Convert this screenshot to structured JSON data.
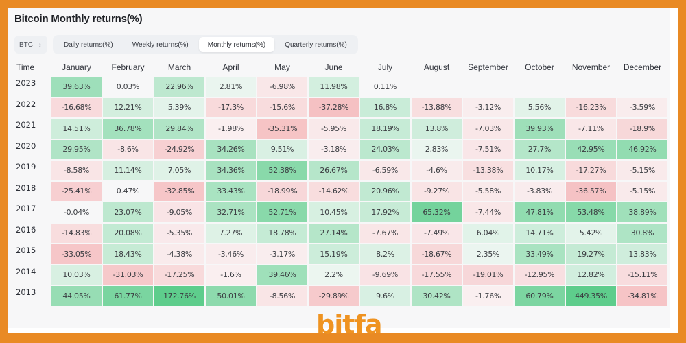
{
  "title": "Bitcoin Monthly returns(%)",
  "asset_select": {
    "value": "BTC",
    "icon": "updown-chevron-icon"
  },
  "tabs": [
    {
      "label": "Daily returns(%)",
      "active": false
    },
    {
      "label": "Weekly returns(%)",
      "active": false
    },
    {
      "label": "Monthly returns(%)",
      "active": true
    },
    {
      "label": "Quarterly returns(%)",
      "active": false
    }
  ],
  "watermark": "bitfa",
  "colors": {
    "frame": "#e98a24",
    "positive_strong": "#5fcf8e",
    "positive_light": "#e8f6ef",
    "negative_strong": "#f4b9bc",
    "negative_light": "#fbeef0"
  },
  "chart_data": {
    "type": "heatmap",
    "title": "Bitcoin Monthly returns(%)",
    "row_header": "Time",
    "columns": [
      "January",
      "February",
      "March",
      "April",
      "May",
      "June",
      "July",
      "August",
      "September",
      "October",
      "November",
      "December"
    ],
    "rows": [
      {
        "year": "2023",
        "values": [
          "39.63%",
          "0.03%",
          "22.96%",
          "2.81%",
          "-6.98%",
          "11.98%",
          "0.11%",
          null,
          null,
          null,
          null,
          null
        ]
      },
      {
        "year": "2022",
        "values": [
          "-16.68%",
          "12.21%",
          "5.39%",
          "-17.3%",
          "-15.6%",
          "-37.28%",
          "16.8%",
          "-13.88%",
          "-3.12%",
          "5.56%",
          "-16.23%",
          "-3.59%"
        ]
      },
      {
        "year": "2021",
        "values": [
          "14.51%",
          "36.78%",
          "29.84%",
          "-1.98%",
          "-35.31%",
          "-5.95%",
          "18.19%",
          "13.8%",
          "-7.03%",
          "39.93%",
          "-7.11%",
          "-18.9%"
        ]
      },
      {
        "year": "2020",
        "values": [
          "29.95%",
          "-8.6%",
          "-24.92%",
          "34.26%",
          "9.51%",
          "-3.18%",
          "24.03%",
          "2.83%",
          "-7.51%",
          "27.7%",
          "42.95%",
          "46.92%"
        ]
      },
      {
        "year": "2019",
        "values": [
          "-8.58%",
          "11.14%",
          "7.05%",
          "34.36%",
          "52.38%",
          "26.67%",
          "-6.59%",
          "-4.6%",
          "-13.38%",
          "10.17%",
          "-17.27%",
          "-5.15%"
        ]
      },
      {
        "year": "2018",
        "values": [
          "-25.41%",
          "0.47%",
          "-32.85%",
          "33.43%",
          "-18.99%",
          "-14.62%",
          "20.96%",
          "-9.27%",
          "-5.58%",
          "-3.83%",
          "-36.57%",
          "-5.15%"
        ]
      },
      {
        "year": "2017",
        "values": [
          "-0.04%",
          "23.07%",
          "-9.05%",
          "32.71%",
          "52.71%",
          "10.45%",
          "17.92%",
          "65.32%",
          "-7.44%",
          "47.81%",
          "53.48%",
          "38.89%"
        ]
      },
      {
        "year": "2016",
        "values": [
          "-14.83%",
          "20.08%",
          "-5.35%",
          "7.27%",
          "18.78%",
          "27.14%",
          "-7.67%",
          "-7.49%",
          "6.04%",
          "14.71%",
          "5.42%",
          "30.8%"
        ]
      },
      {
        "year": "2015",
        "values": [
          "-33.05%",
          "18.43%",
          "-4.38%",
          "-3.46%",
          "-3.17%",
          "15.19%",
          "8.2%",
          "-18.67%",
          "2.35%",
          "33.49%",
          "19.27%",
          "13.83%"
        ]
      },
      {
        "year": "2014",
        "values": [
          "10.03%",
          "-31.03%",
          "-17.25%",
          "-1.6%",
          "39.46%",
          "2.2%",
          "-9.69%",
          "-17.55%",
          "-19.01%",
          "-12.95%",
          "12.82%",
          "-15.11%"
        ]
      },
      {
        "year": "2013",
        "values": [
          "44.05%",
          "61.77%",
          "172.76%",
          "50.01%",
          "-8.56%",
          "-29.89%",
          "9.6%",
          "30.42%",
          "-1.76%",
          "60.79%",
          "449.35%",
          "-34.81%"
        ]
      }
    ]
  }
}
